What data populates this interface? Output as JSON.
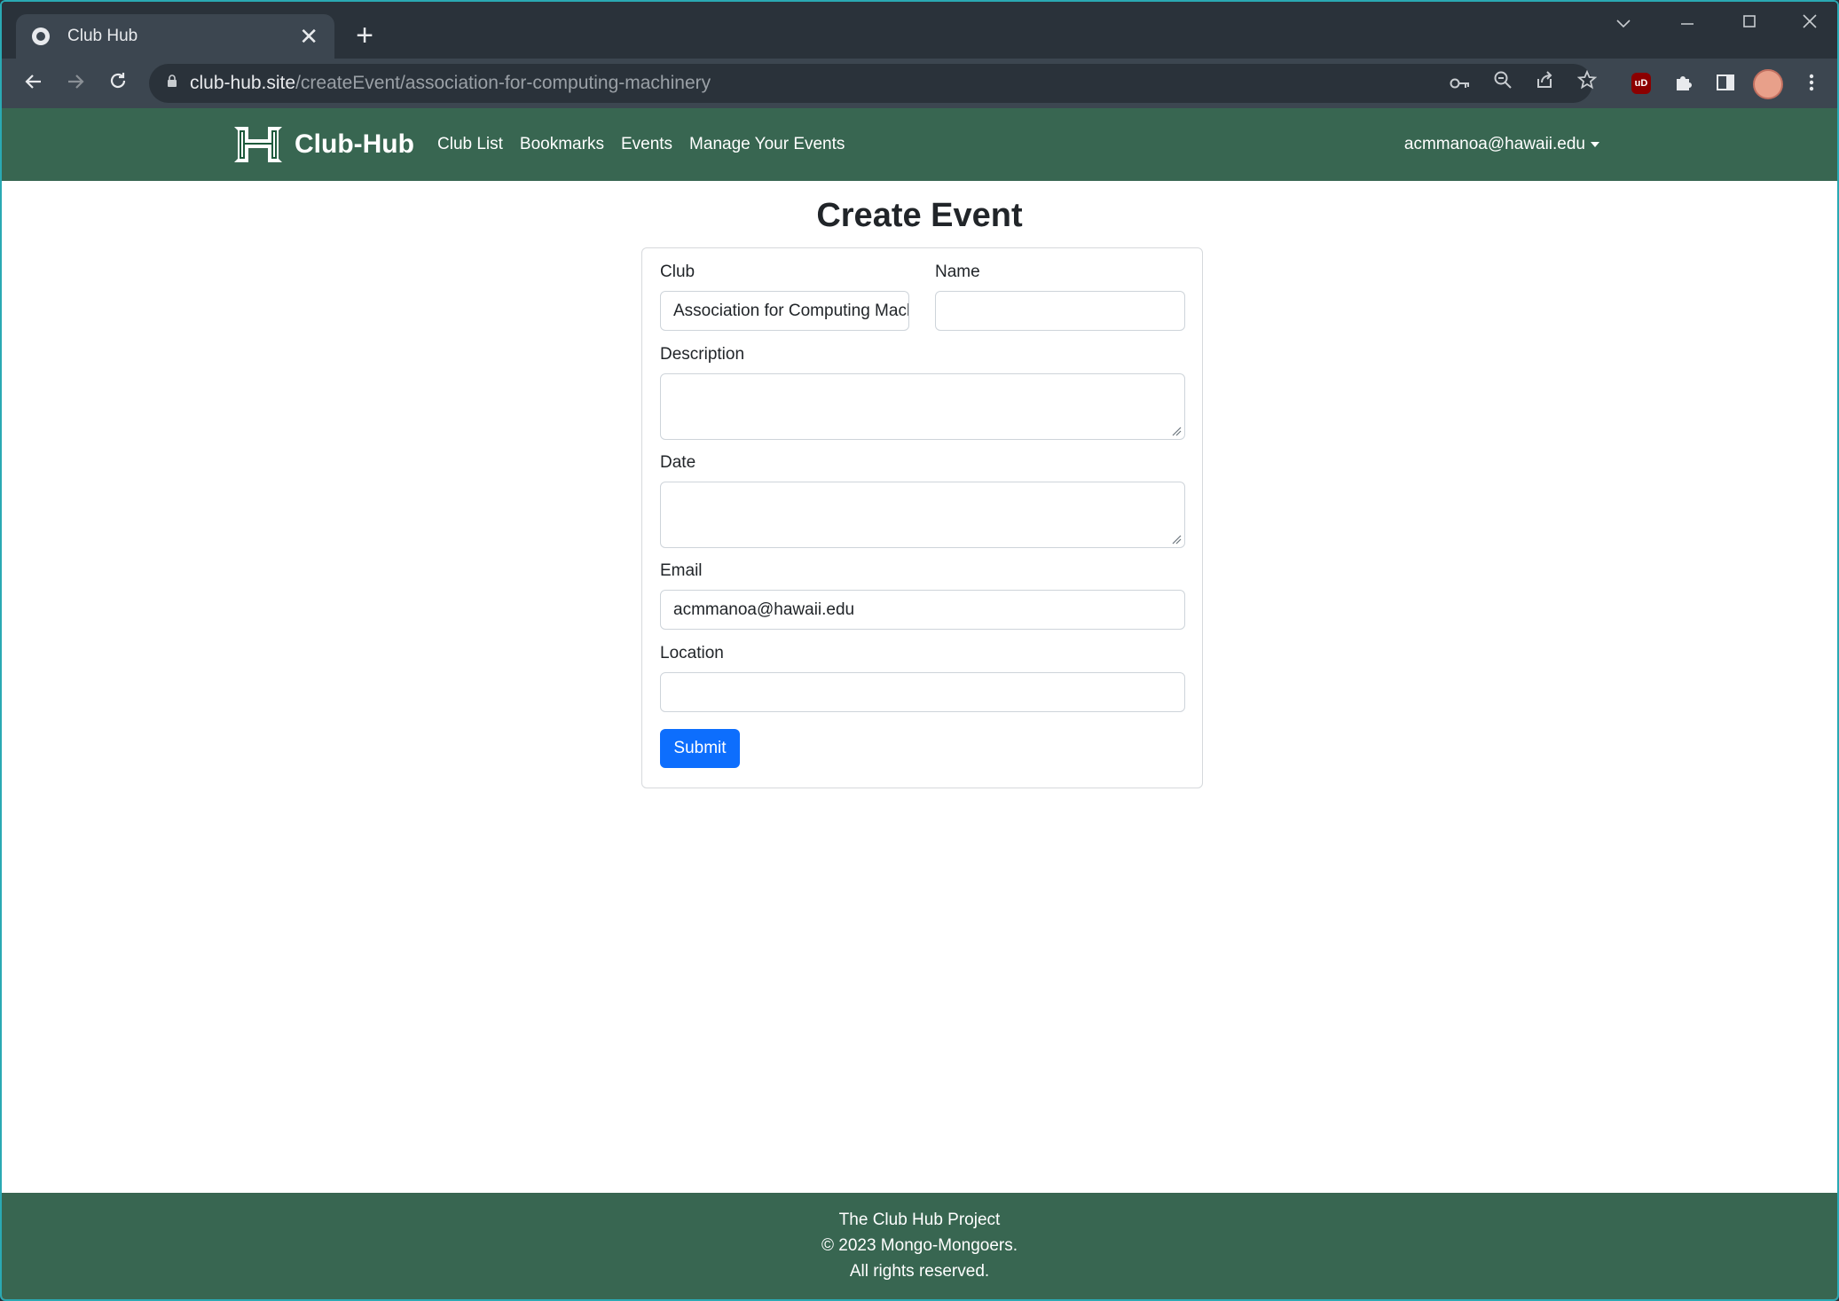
{
  "browser": {
    "tab_title": "Club Hub",
    "tab_close": "✕",
    "new_tab": "+",
    "url_host": "club-hub.site",
    "url_path": "/createEvent/association-for-computing-machinery",
    "ublock_label": "uD"
  },
  "navbar": {
    "brand": "Club-Hub",
    "links": [
      "Club List",
      "Bookmarks",
      "Events",
      "Manage Your Events"
    ],
    "user": "acmmanoa@hawaii.edu"
  },
  "form": {
    "title": "Create Event",
    "club_label": "Club",
    "club_value": "Association for Computing Machinery",
    "name_label": "Name",
    "name_value": "",
    "description_label": "Description",
    "description_value": "",
    "date_label": "Date",
    "date_value": "",
    "email_label": "Email",
    "email_value": "acmmanoa@hawaii.edu",
    "location_label": "Location",
    "location_value": "",
    "submit_label": "Submit"
  },
  "footer": {
    "line1": "The Club Hub Project",
    "line2": "© 2023 Mongo-Mongoers.",
    "line3": "All rights reserved."
  },
  "colors": {
    "navbar": "#386651",
    "submit": "#0d6efd",
    "window_border": "#2aa9b3"
  },
  "icons": [
    "favicon-icon",
    "close-icon",
    "plus-icon",
    "back-icon",
    "forward-icon",
    "reload-icon",
    "lock-icon",
    "key-icon",
    "zoom-icon",
    "share-icon",
    "star-icon",
    "ublock-icon",
    "puzzle-icon",
    "sidepanel-icon",
    "avatar",
    "kebab-menu-icon",
    "chevron-down-icon",
    "minimize-icon",
    "maximize-icon",
    "window-close-icon",
    "h-logo-icon",
    "caret-down-icon"
  ]
}
